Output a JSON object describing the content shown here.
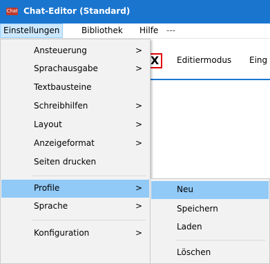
{
  "window": {
    "title": "Chat-Editor (Standard)",
    "icon": "app-icon"
  },
  "menubar": {
    "items": [
      "Einstellungen",
      "Bibliothek",
      "Hilfe",
      "---"
    ]
  },
  "toolbar": {
    "close_glyph": "X",
    "labels": [
      "Editiermodus",
      "Eing"
    ]
  },
  "menu": {
    "items": [
      {
        "label": "Ansteuerung",
        "has_submenu": true
      },
      {
        "label": "Sprachausgabe",
        "has_submenu": true
      },
      {
        "label": "Textbausteine",
        "has_submenu": false
      },
      {
        "label": "Schreibhilfen",
        "has_submenu": true
      },
      {
        "label": "Layout",
        "has_submenu": true
      },
      {
        "label": "Anzeigeformat",
        "has_submenu": true
      },
      {
        "label": "Seiten drucken",
        "has_submenu": false
      },
      {
        "label": "Profile",
        "has_submenu": true,
        "highlighted": true
      },
      {
        "label": "Sprache",
        "has_submenu": true
      },
      {
        "label": "Konfiguration",
        "has_submenu": true
      }
    ],
    "arrow_glyph": ">"
  },
  "submenu": {
    "items": [
      {
        "label": "Neu",
        "highlighted": true
      },
      {
        "label": "Speichern"
      },
      {
        "label": "Laden"
      },
      {
        "label": "Löschen"
      }
    ]
  },
  "colors": {
    "titlebar": "#1a75cf",
    "highlight": "#91c9f7",
    "menu_bg": "#f2f2f2",
    "close_border": "#e00000"
  }
}
